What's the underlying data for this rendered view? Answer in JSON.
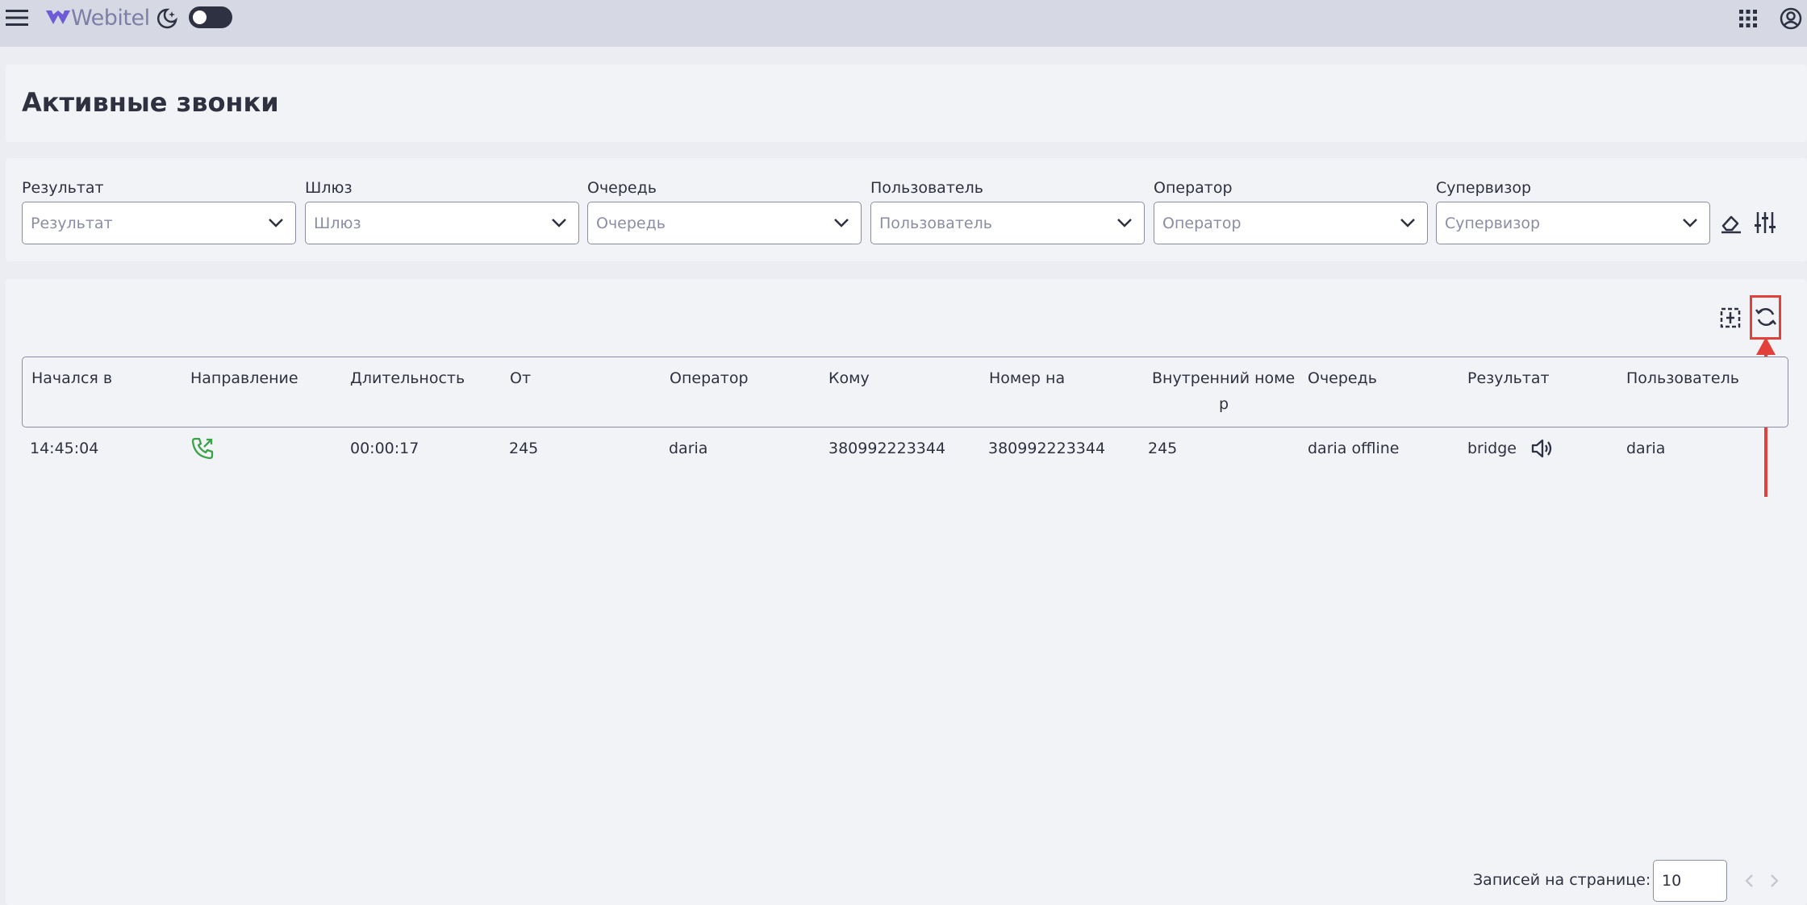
{
  "app": {
    "logo_text": "Webitel"
  },
  "page": {
    "title": "Активные звонки"
  },
  "filters": [
    {
      "label": "Результат",
      "placeholder": "Результат"
    },
    {
      "label": "Шлюз",
      "placeholder": "Шлюз"
    },
    {
      "label": "Очередь",
      "placeholder": "Очередь"
    },
    {
      "label": "Пользователь",
      "placeholder": "Пользователь"
    },
    {
      "label": "Оператор",
      "placeholder": "Оператор"
    },
    {
      "label": "Супервизор",
      "placeholder": "Супервизор"
    }
  ],
  "table": {
    "columns": [
      "Начался в",
      "Направление",
      "Длительность",
      "От",
      "Оператор",
      "Кому",
      "Номер на",
      "Внутренний номе",
      "Очередь",
      "Результат",
      "Пользователь"
    ],
    "column_wrap": "р",
    "rows": [
      {
        "started_at": "14:45:04",
        "direction_icon": "outbound-call-icon",
        "duration": "00:00:17",
        "from": "245",
        "operator": "daria",
        "to": "380992223344",
        "number": "380992223344",
        "extension": "245",
        "queue": "daria offline",
        "result": "bridge",
        "user": "daria"
      }
    ]
  },
  "pagination": {
    "per_page_label": "Записей на странице:",
    "per_page_value": "10"
  },
  "icons": {
    "menu": "hamburger-menu-icon",
    "theme": "moon-stars-icon",
    "apps": "apps-grid-icon",
    "account": "account-circle-icon",
    "clear_filters": "eraser-icon",
    "filter_settings": "sliders-icon",
    "expand_columns": "column-expand-icon",
    "refresh": "refresh-icon",
    "listen": "speaker-icon"
  },
  "colors": {
    "accent_logo": "#6f5bd6",
    "direction_green": "#3aa347",
    "highlight_red": "#e2403a"
  }
}
